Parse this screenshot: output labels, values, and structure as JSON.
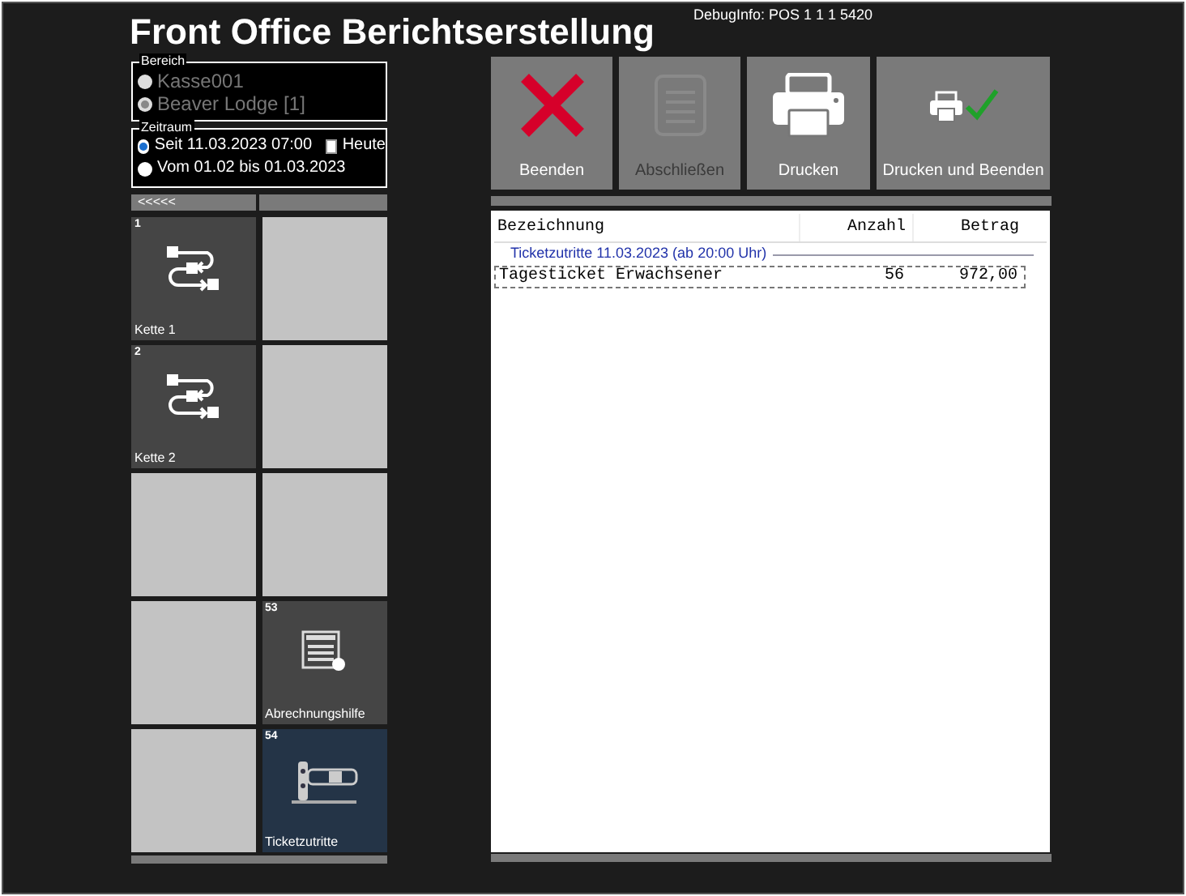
{
  "window": {
    "title": "Front Office Berichtserstellung",
    "debug_info": "DebugInfo: POS 1 1 1 5420"
  },
  "bereich": {
    "label": "Bereich",
    "options": [
      {
        "label": "Kasse001",
        "selected": false,
        "disabled": true
      },
      {
        "label": "Beaver Lodge [1]",
        "selected": true,
        "disabled": true
      }
    ]
  },
  "zeitraum": {
    "label": "Zeitraum",
    "options": [
      {
        "label": "Seit 11.03.2023 07:00",
        "selected": true
      },
      {
        "label": "Vom 01.02 bis 01.03.2023",
        "selected": false
      }
    ],
    "today_checkbox": {
      "label": "Heute",
      "checked": false
    }
  },
  "nav": {
    "back": "<<<<<"
  },
  "tiles": [
    {
      "kind": "chain",
      "number": "1",
      "label": "Kette 1",
      "selected": false
    },
    {
      "kind": "empty"
    },
    {
      "kind": "chain",
      "number": "2",
      "label": "Kette 2",
      "selected": false
    },
    {
      "kind": "empty"
    },
    {
      "kind": "empty"
    },
    {
      "kind": "empty"
    },
    {
      "kind": "empty"
    },
    {
      "kind": "report",
      "number": "53",
      "label": "Abrechnungshilfe",
      "selected": false
    },
    {
      "kind": "empty"
    },
    {
      "kind": "ticket",
      "number": "54",
      "label": "Ticketzutritte",
      "selected": true
    }
  ],
  "buttons": [
    {
      "kind": "close",
      "label": "Beenden",
      "disabled": false
    },
    {
      "kind": "finish",
      "label": "Abschließen",
      "disabled": true
    },
    {
      "kind": "print",
      "label": "Drucken",
      "disabled": false
    },
    {
      "kind": "print_close",
      "label": "Drucken und Beenden",
      "disabled": false
    }
  ],
  "report": {
    "columns": [
      "Bezeichnung",
      "Anzahl",
      "Betrag"
    ],
    "group": "Ticketzutritte 11.03.2023 (ab 20:00 Uhr)",
    "rows": [
      {
        "cells": [
          "Tagesticket Erwachsener",
          "56",
          "972,00"
        ],
        "selected": true
      }
    ]
  }
}
